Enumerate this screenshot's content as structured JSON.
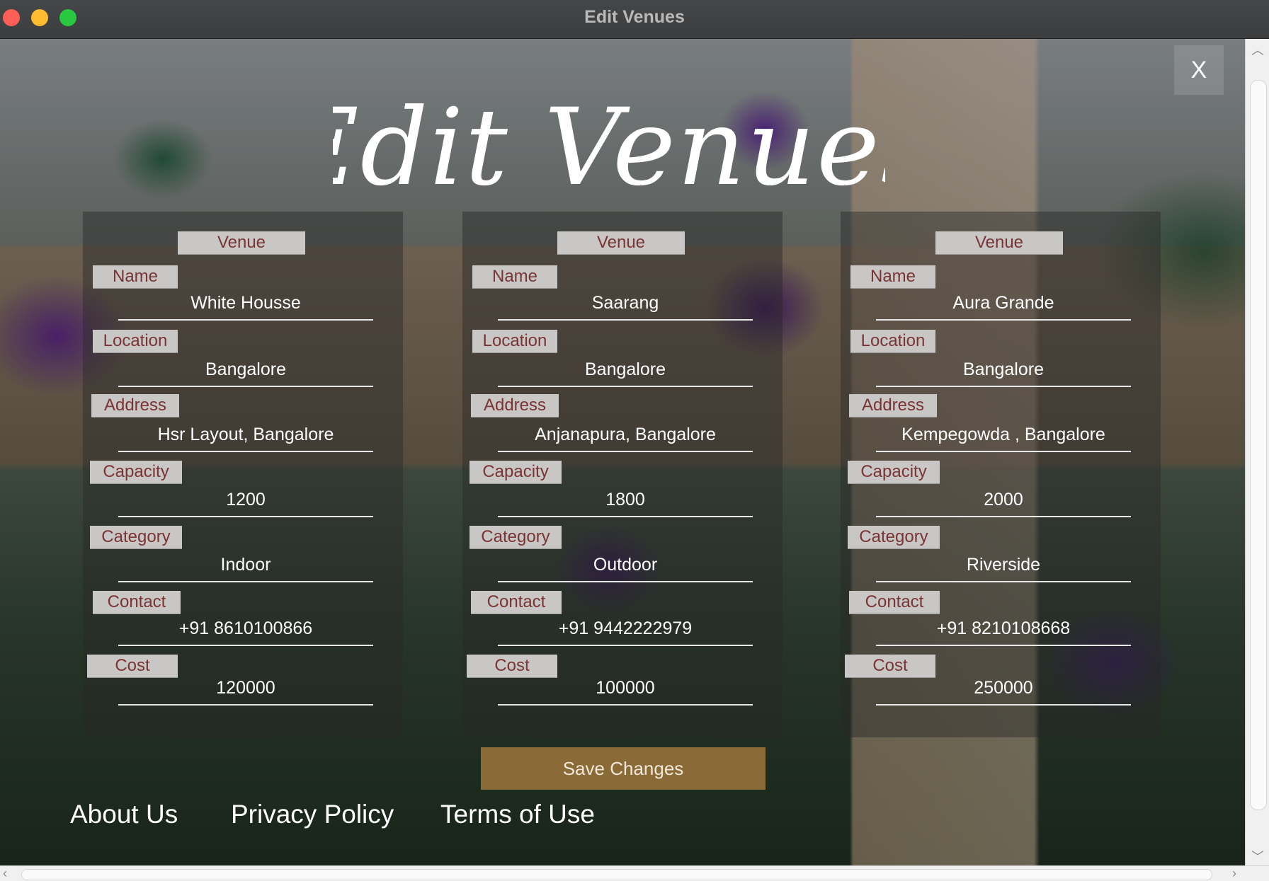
{
  "window": {
    "title": "Edit Venues"
  },
  "close_label": "X",
  "heading": "Edit Venues",
  "labels": {
    "venue": "Venue",
    "name": "Name",
    "location": "Location",
    "address": "Address",
    "capacity": "Capacity",
    "category": "Category",
    "contact": "Contact",
    "cost": "Cost"
  },
  "venues": [
    {
      "name": "White Housse",
      "location": "Bangalore",
      "address": "Hsr Layout, Bangalore",
      "capacity": "1200",
      "category": "Indoor",
      "contact": "+91  8610100866",
      "cost": "120000"
    },
    {
      "name": "Saarang",
      "location": "Bangalore",
      "address": "Anjanapura, Bangalore",
      "capacity": "1800",
      "category": "Outdoor",
      "contact": "+91  9442222979",
      "cost": "100000"
    },
    {
      "name": "Aura Grande",
      "location": "Bangalore",
      "address": "Kempegowda , Bangalore",
      "capacity": "2000",
      "category": "Riverside",
      "contact": "+91  8210108668",
      "cost": "250000"
    }
  ],
  "save_label": "Save Changes",
  "footer": {
    "about": "About Us",
    "privacy": "Privacy Policy",
    "terms": "Terms of Use"
  },
  "colors": {
    "tag_bg": "#c9c6c6",
    "tag_text": "#7a3434",
    "save_bg": "#8a6a36"
  }
}
